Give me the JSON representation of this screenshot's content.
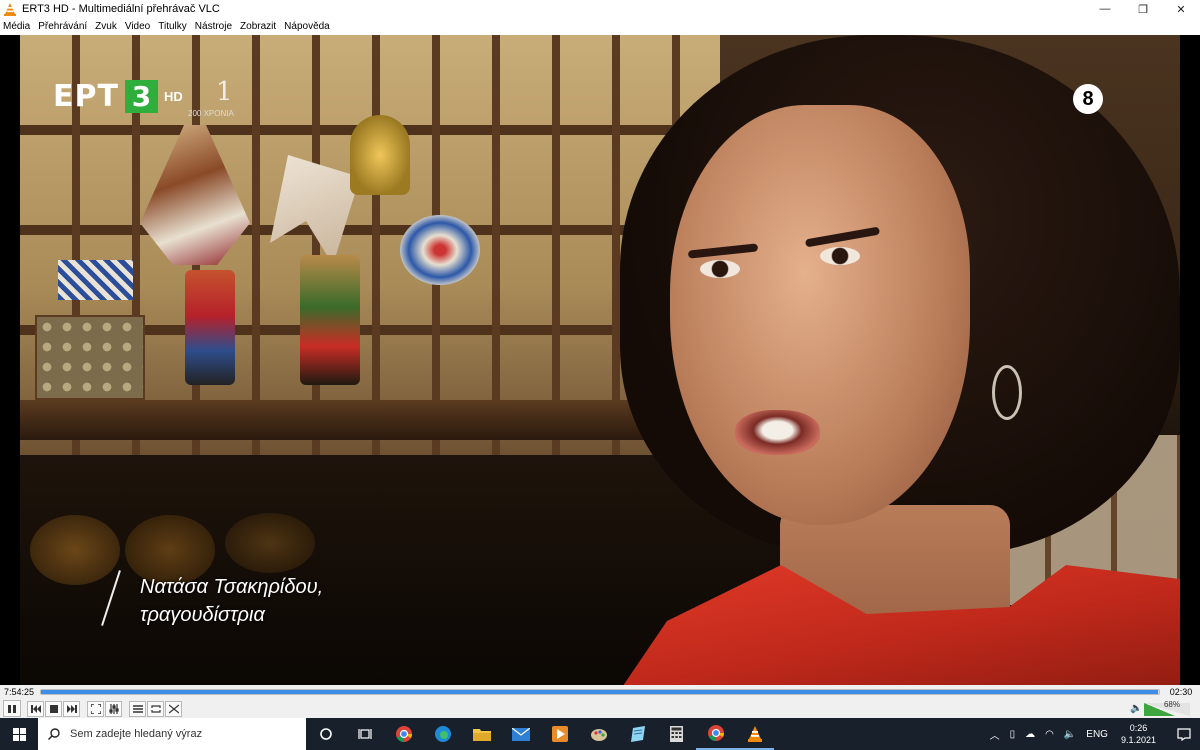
{
  "window": {
    "title": "ERT3 HD - Multimediální přehrávač VLC",
    "minimize": "—",
    "maximize": "❐",
    "close": "✕"
  },
  "menu": [
    "Média",
    "Přehrávání",
    "Zvuk",
    "Video",
    "Titulky",
    "Nástroje",
    "Zobrazit",
    "Nápověda"
  ],
  "overlay": {
    "channel": "ΕΡΤ",
    "channel_num": "3",
    "hd": "HD",
    "anniversary": "200 ΧΡΟΝΙΑ",
    "anniversary_num": "1",
    "rating": "8",
    "caption_line1": "Νατάσα Τσακηρίδου,",
    "caption_line2": "τραγουδίστρια"
  },
  "player": {
    "elapsed": "7:54:25",
    "remaining": "02:30",
    "progress": 0.999,
    "volume_label": "68%",
    "volume": 0.68
  },
  "taskbar": {
    "search_placeholder": "Sem zadejte hledaný výraz",
    "language": "ENG",
    "time": "0:26",
    "date": "9.1.2021"
  },
  "colors": {
    "ert_green": "#2fae3c",
    "seek_fill": "#3c8ee6",
    "volume_fill": "#3ea63e",
    "taskbar_bg": "#18202b"
  }
}
